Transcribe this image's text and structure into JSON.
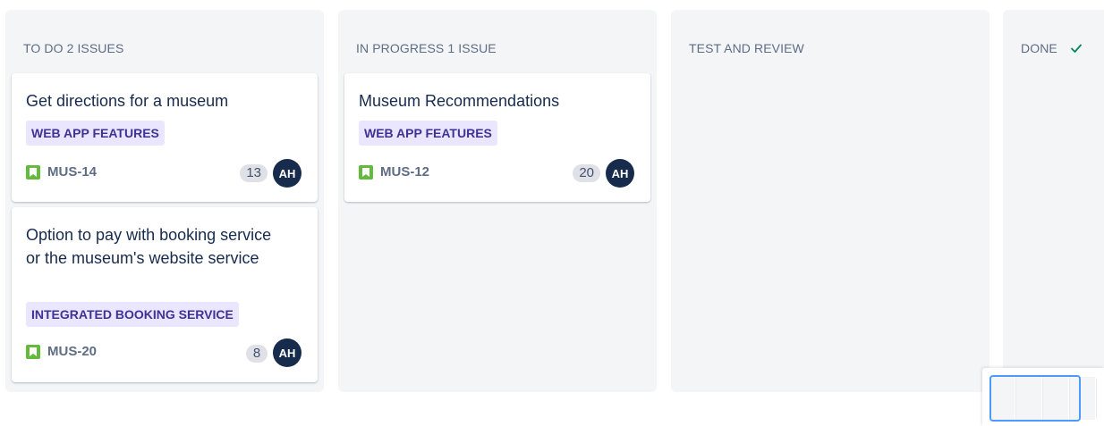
{
  "columns": [
    {
      "title": "TO DO 2 ISSUES"
    },
    {
      "title": "IN PROGRESS 1 ISSUE"
    },
    {
      "title": "TEST AND REVIEW"
    },
    {
      "title": "DONE"
    }
  ],
  "cards": [
    {
      "title": "Get directions for a museum",
      "epic": "WEB APP FEATURES",
      "key": "MUS-14",
      "points": "13",
      "assignee": "AH"
    },
    {
      "title": "Option to pay with booking service or the museum's website service",
      "epic": "INTEGRATED BOOKING SERVICE",
      "key": "MUS-20",
      "points": "8",
      "assignee": "AH"
    },
    {
      "title": "Museum Recommendations",
      "epic": "WEB APP FEATURES",
      "key": "MUS-12",
      "points": "20",
      "assignee": "AH"
    }
  ],
  "icons": {
    "story": "bookmark-icon",
    "done": "check-icon"
  },
  "colors": {
    "column_bg": "#f4f5f7",
    "epic_bg": "#eae6ff",
    "epic_text": "#403294",
    "story_icon": "#63ba3c",
    "avatar_bg": "#172b4d",
    "done_check": "#00875a",
    "minimap_viewport": "#4c9aff"
  }
}
